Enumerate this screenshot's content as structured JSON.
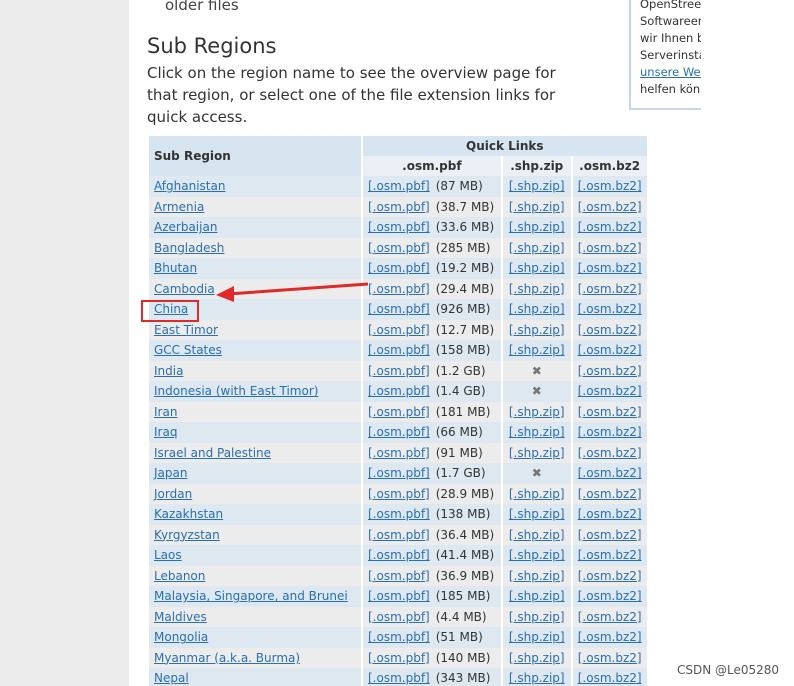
{
  "page": {
    "older_files": "older files",
    "sidebar_lines": [
      "OpenStreet",
      "Softwareen",
      "wir Ihnen be",
      "Serverinstal"
    ],
    "sidebar_link": "unsere Web",
    "sidebar_tail": "helfen könn",
    "heading": "Sub Regions",
    "intro": "Click on the region name to see the overview page for that region, or select one of the file extension links for quick access.",
    "watermark": "CSDN @Le05280"
  },
  "table": {
    "col_region": "Sub Region",
    "col_quick": "Quick Links",
    "col_pbf": ".osm.pbf",
    "col_shp": ".shp.zip",
    "col_bz2": ".osm.bz2",
    "pbf_label": "[.osm.pbf]",
    "shp_label": "[.shp.zip]",
    "bz2_label": "[.osm.bz2]",
    "rows": [
      {
        "name": "Afghanistan",
        "size": "(87 MB)",
        "shp": true
      },
      {
        "name": "Armenia",
        "size": "(38.7 MB)",
        "shp": true
      },
      {
        "name": "Azerbaijan",
        "size": "(33.6 MB)",
        "shp": true
      },
      {
        "name": "Bangladesh",
        "size": "(285 MB)",
        "shp": true
      },
      {
        "name": "Bhutan",
        "size": "(19.2 MB)",
        "shp": true
      },
      {
        "name": "Cambodia",
        "size": "(29.4 MB)",
        "shp": true
      },
      {
        "name": "China",
        "size": "(926 MB)",
        "shp": true
      },
      {
        "name": "East Timor",
        "size": "(12.7 MB)",
        "shp": true
      },
      {
        "name": "GCC States",
        "size": "(158 MB)",
        "shp": true
      },
      {
        "name": "India",
        "size": "(1.2 GB)",
        "shp": false
      },
      {
        "name": "Indonesia (with East Timor)",
        "size": "(1.4 GB)",
        "shp": false
      },
      {
        "name": "Iran",
        "size": "(181 MB)",
        "shp": true
      },
      {
        "name": "Iraq",
        "size": "(66 MB)",
        "shp": true
      },
      {
        "name": "Israel and Palestine",
        "size": "(91 MB)",
        "shp": true
      },
      {
        "name": "Japan",
        "size": "(1.7 GB)",
        "shp": false
      },
      {
        "name": "Jordan",
        "size": "(28.9 MB)",
        "shp": true
      },
      {
        "name": "Kazakhstan",
        "size": "(138 MB)",
        "shp": true
      },
      {
        "name": "Kyrgyzstan",
        "size": "(36.4 MB)",
        "shp": true
      },
      {
        "name": "Laos",
        "size": "(41.4 MB)",
        "shp": true
      },
      {
        "name": "Lebanon",
        "size": "(36.9 MB)",
        "shp": true
      },
      {
        "name": "Malaysia, Singapore, and Brunei",
        "size": "(185 MB)",
        "shp": true
      },
      {
        "name": "Maldives",
        "size": "(4.4 MB)",
        "shp": true
      },
      {
        "name": "Mongolia",
        "size": "(51 MB)",
        "shp": true
      },
      {
        "name": "Myanmar (a.k.a. Burma)",
        "size": "(140 MB)",
        "shp": true
      },
      {
        "name": "Nepal",
        "size": "(343 MB)",
        "shp": true
      }
    ],
    "no_shp_icon": "close-x-icon",
    "no_shp_glyph": "✖"
  },
  "annotation": {
    "highlight_color": "#e02a2a",
    "highlighted_region": "China"
  }
}
